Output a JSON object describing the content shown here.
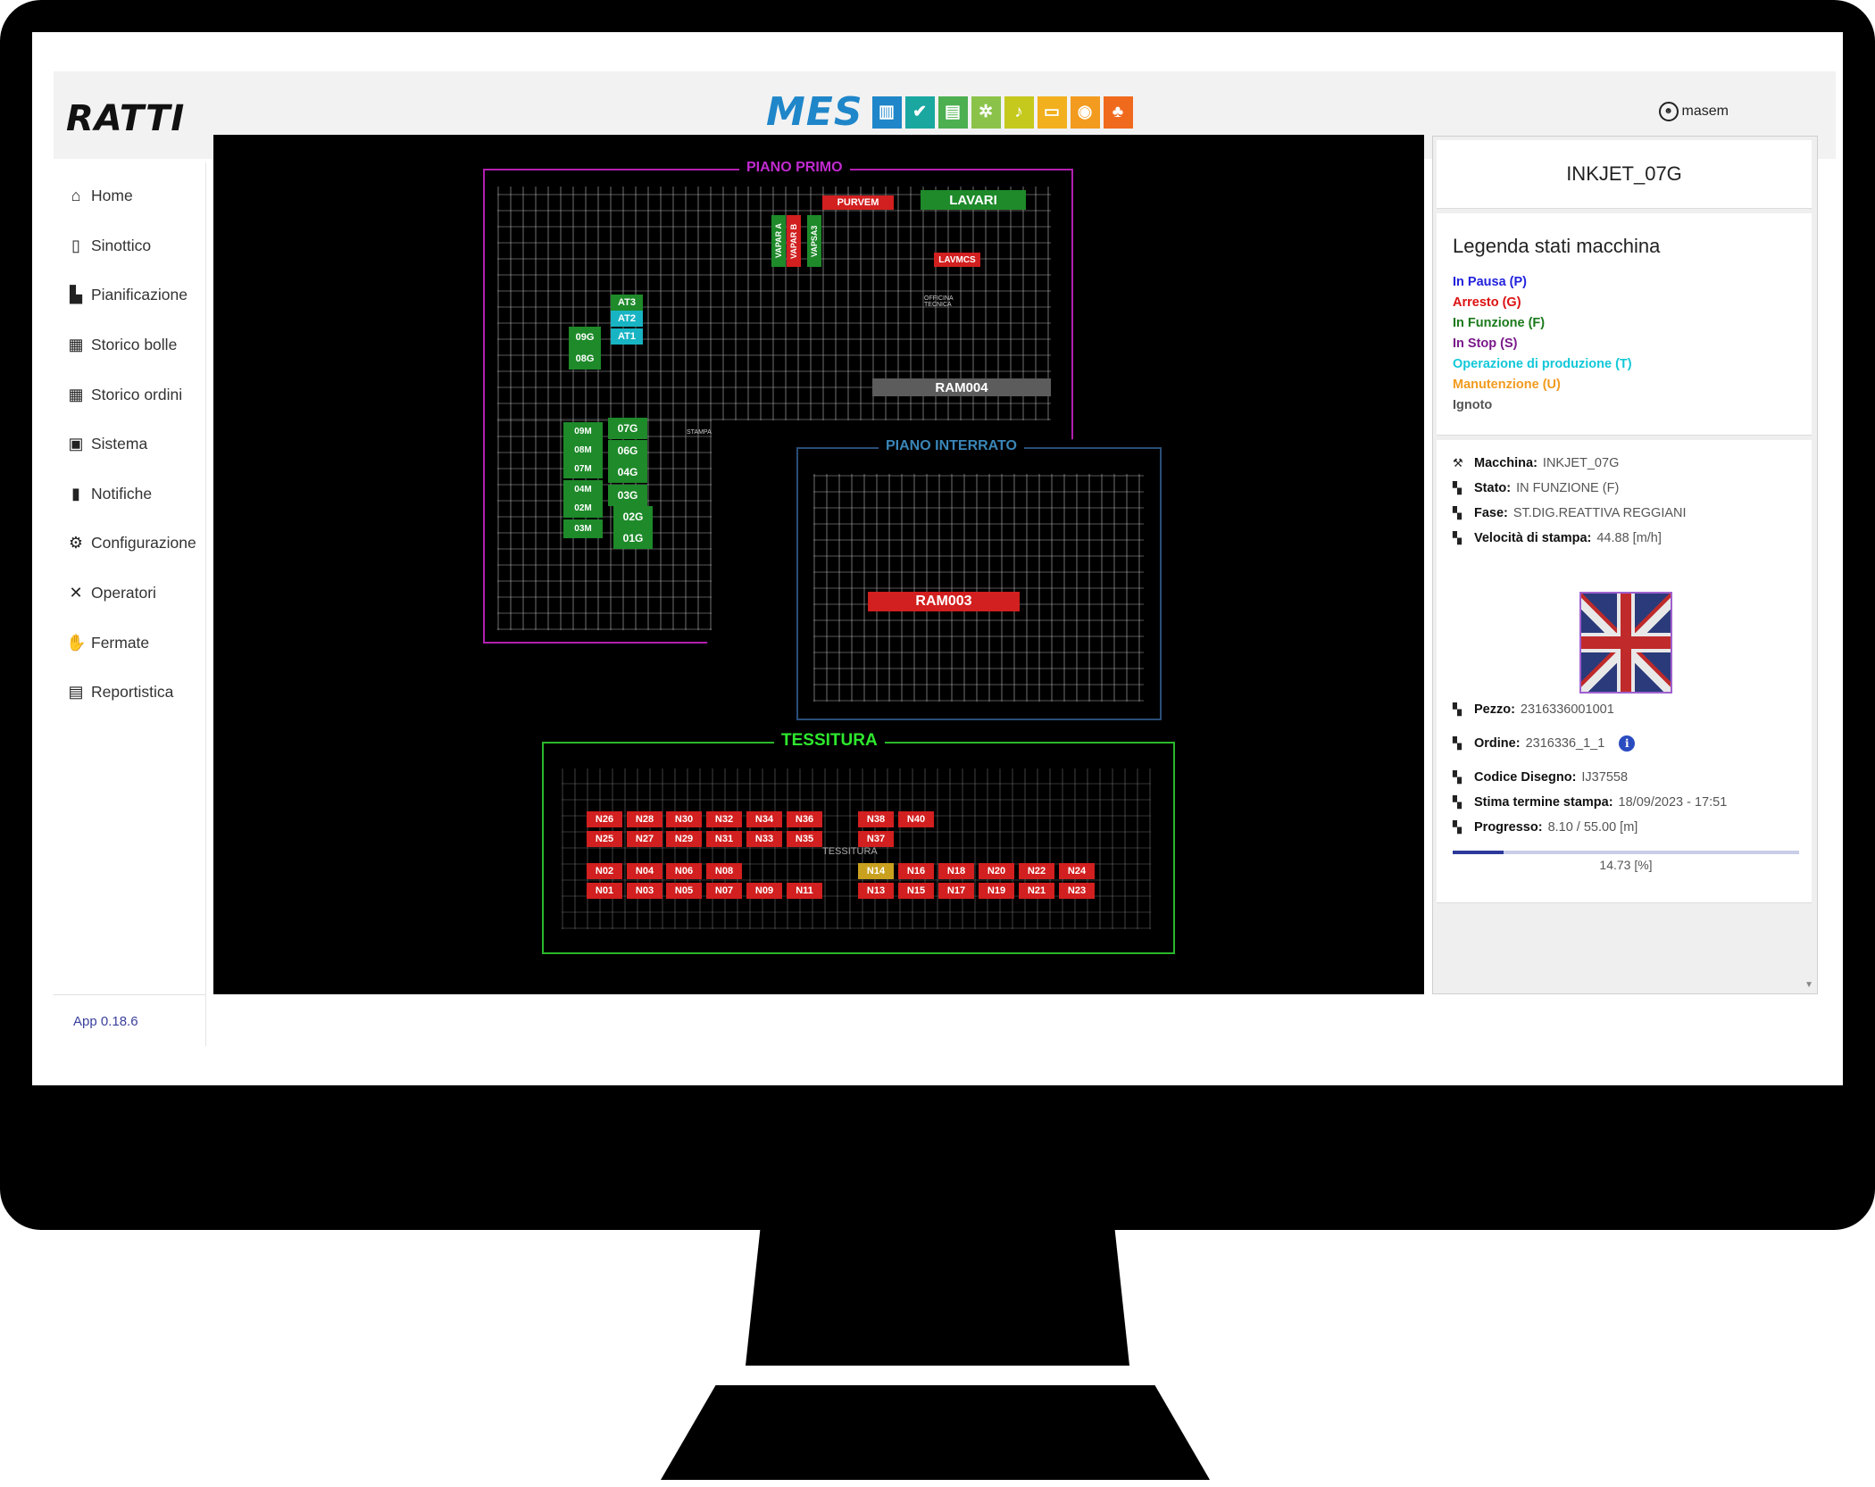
{
  "brand": {
    "logo": "RATTI",
    "mes_label": "MES"
  },
  "user": {
    "name": "masem"
  },
  "nav": [
    {
      "label": "Home",
      "icon": "home-icon"
    },
    {
      "label": "Sinottico",
      "icon": "map-icon"
    },
    {
      "label": "Pianificazione",
      "icon": "factory-icon"
    },
    {
      "label": "Storico bolle",
      "icon": "chart-icon"
    },
    {
      "label": "Storico ordini",
      "icon": "chart-icon"
    },
    {
      "label": "Sistema",
      "icon": "monitor-pulse-icon"
    },
    {
      "label": "Notifiche",
      "icon": "alert-icon"
    },
    {
      "label": "Configurazione",
      "icon": "gear-icon"
    },
    {
      "label": "Operatori",
      "icon": "tools-icon"
    },
    {
      "label": "Fermate",
      "icon": "hand-icon"
    },
    {
      "label": "Reportistica",
      "icon": "document-icon"
    }
  ],
  "version": "App 0.18.6",
  "header_icons": [
    {
      "name": "bar-chart-icon",
      "color": "#1f86c9",
      "glyph": "▥"
    },
    {
      "name": "check-circle-icon",
      "color": "#19a7a0",
      "glyph": "✔"
    },
    {
      "name": "list-icon",
      "color": "#4caf50",
      "glyph": "▤"
    },
    {
      "name": "gears-icon",
      "color": "#8bc34a",
      "glyph": "✲"
    },
    {
      "name": "bell-icon",
      "color": "#c5c91d",
      "glyph": "♪"
    },
    {
      "name": "screen-icon",
      "color": "#f2b01e",
      "glyph": "▭"
    },
    {
      "name": "eye-icon",
      "color": "#f29b1e",
      "glyph": "◉"
    },
    {
      "name": "hierarchy-icon",
      "color": "#f06a1e",
      "glyph": "♣"
    }
  ],
  "map": {
    "floors": {
      "primo": "PIANO PRIMO",
      "interrato": "PIANO INTERRATO",
      "tessitura": "TESSITURA"
    },
    "machines_primo": [
      {
        "label": "PURVEM",
        "color": "red"
      },
      {
        "label": "LAVARI",
        "color": "green"
      },
      {
        "label": "LAVMCS",
        "color": "red"
      },
      {
        "label": "VAPAR A",
        "color": "green"
      },
      {
        "label": "VAPAR B",
        "color": "red"
      },
      {
        "label": "VAPSA3",
        "color": "green"
      },
      {
        "label": "AT3",
        "color": "green"
      },
      {
        "label": "AT2",
        "color": "cyan"
      },
      {
        "label": "AT1",
        "color": "cyan"
      },
      {
        "label": "09G",
        "color": "green"
      },
      {
        "label": "08G",
        "color": "green"
      },
      {
        "label": "RAM004",
        "color": "gray"
      },
      {
        "label": "07G",
        "color": "green"
      },
      {
        "label": "06G",
        "color": "green"
      },
      {
        "label": "04G",
        "color": "green"
      },
      {
        "label": "03G",
        "color": "green"
      },
      {
        "label": "02G",
        "color": "green"
      },
      {
        "label": "01G",
        "color": "green"
      },
      {
        "label": "09M",
        "color": "green"
      },
      {
        "label": "08M",
        "color": "green"
      },
      {
        "label": "07M",
        "color": "green"
      },
      {
        "label": "04M",
        "color": "green"
      },
      {
        "label": "02M",
        "color": "green"
      },
      {
        "label": "03M",
        "color": "green"
      }
    ],
    "machines_interrato": [
      {
        "label": "RAM003",
        "color": "red"
      }
    ],
    "tess_row1": [
      "N26",
      "N28",
      "N30",
      "N32",
      "N34",
      "N36"
    ],
    "tess_row2": [
      "N25",
      "N27",
      "N29",
      "N31",
      "N33",
      "N35"
    ],
    "tess_row1b": [
      "N38",
      "N40"
    ],
    "tess_row2b": [
      "N37"
    ],
    "tess_row3": [
      "N02",
      "N04",
      "N06",
      "N08"
    ],
    "tess_row4": [
      "N01",
      "N03",
      "N05",
      "N07",
      "N09",
      "N11"
    ],
    "tess_row3b": [
      "N14",
      "N16",
      "N18",
      "N20",
      "N22",
      "N24"
    ],
    "tess_row4b": [
      "N13",
      "N15",
      "N17",
      "N19",
      "N21",
      "N23"
    ],
    "tess_label": "TESSITURA",
    "drawing_labels": {
      "stampa": "STAMPA",
      "officina": "OFFICINA TECNICA"
    }
  },
  "panel": {
    "machine_title": "INKJET_07G",
    "legend_title": "Legenda stati macchina",
    "legend": [
      {
        "label": "In Pausa (P)",
        "color": "#2222dd"
      },
      {
        "label": "Arresto (G)",
        "color": "#dd1111"
      },
      {
        "label": "In Funzione (F)",
        "color": "#1a7a1a"
      },
      {
        "label": "In Stop (S)",
        "color": "#7a1a8a"
      },
      {
        "label": "Operazione di produzione (T)",
        "color": "#12c8d8"
      },
      {
        "label": "Manutenzione (U)",
        "color": "#f29b1e"
      },
      {
        "label": "Ignoto",
        "color": "#555555"
      }
    ],
    "info": {
      "macchina_k": "Macchina:",
      "macchina_v": "INKJET_07G",
      "stato_k": "Stato:",
      "stato_v": "IN FUNZIONE (F)",
      "fase_k": "Fase:",
      "fase_v": "ST.DIG.REATTIVA REGGIANI",
      "vel_k": "Velocità di stampa:",
      "vel_v": "44.88 [m/h]"
    },
    "job": {
      "pezzo_k": "Pezzo:",
      "pezzo_v": "2316336001001",
      "ordine_k": "Ordine:",
      "ordine_v": "2316336_1_1",
      "codice_k": "Codice Disegno:",
      "codice_v": "IJ37558",
      "stima_k": "Stima termine stampa:",
      "stima_v": "18/09/2023 - 17:51",
      "prog_k": "Progresso:",
      "prog_v": "8.10 / 55.00 [m]",
      "progress_pct_label": "14.73 [%]",
      "progress_fraction": 0.1473
    }
  }
}
